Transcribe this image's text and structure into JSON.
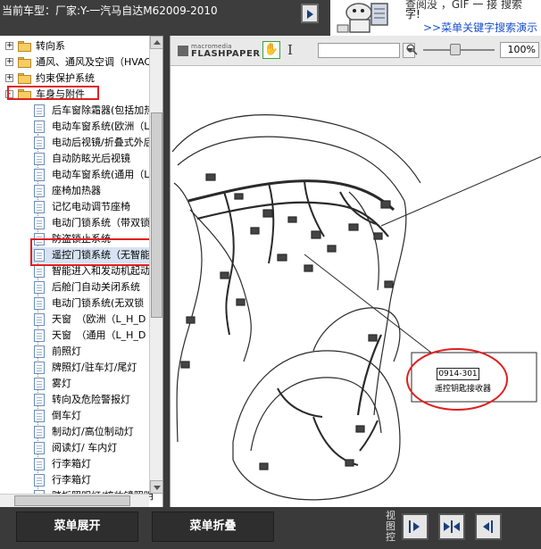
{
  "header": {
    "title": "当前车型：厂家:Y-一汽马自达M62009-2010"
  },
  "ad": {
    "top_text": "查阅没 ，GIF 一  接 搜索",
    "mid_text": "字!",
    "link_text": ">>菜单关键字搜索演示"
  },
  "tree": {
    "top_items": [
      {
        "label": "转向系",
        "expander": "+"
      },
      {
        "label": "通风、通风及空调（HVAC",
        "expander": "+"
      },
      {
        "label": "约束保护系统",
        "expander": "+"
      },
      {
        "label": "车身与附件",
        "expander": "-"
      }
    ],
    "child_items": [
      {
        "label": "后车窗除霜器(包括加热"
      },
      {
        "label": "电动车窗系统(欧洲（L"
      },
      {
        "label": "电动后视镜/折叠式外后"
      },
      {
        "label": "自动防眩光后视镜"
      },
      {
        "label": "电动车窗系统(通用（L"
      },
      {
        "label": "座椅加热器"
      },
      {
        "label": "记忆电动调节座椅"
      },
      {
        "label": "电动门锁系统（带双锁"
      },
      {
        "label": "防盗锁止系统"
      },
      {
        "label": "遥控门锁系统（无智能"
      },
      {
        "label": "智能进入和发动机起动"
      },
      {
        "label": "后舱门自动关闭系统"
      },
      {
        "label": "电动门锁系统(无双锁"
      },
      {
        "label": "天窗　（欧洲（L_H_D"
      },
      {
        "label": "天窗　（通用（L_H_D"
      },
      {
        "label": "前照灯"
      },
      {
        "label": "牌照灯/驻车灯/尾灯"
      },
      {
        "label": "雾灯"
      },
      {
        "label": "转向及危险警报灯"
      },
      {
        "label": "倒车灯"
      },
      {
        "label": "制动灯/高位制动灯"
      },
      {
        "label": "阅读灯/ 车内灯"
      },
      {
        "label": "行李箱灯"
      },
      {
        "label": "行李箱灯"
      },
      {
        "label": "踏板照明灯/梳妆镜照明"
      }
    ],
    "selected_label": "遥控门锁系统（无智能"
  },
  "viewer": {
    "logo_line1": "macromedia",
    "logo_line2": "FLASHPAPER",
    "zoom": "100%",
    "callout_code": "0914-301",
    "callout_text": "遥控钥匙接收器"
  },
  "bottom": {
    "expand_label": "菜单展开",
    "collapse_label": "菜单折叠",
    "view_label": "视图控"
  }
}
